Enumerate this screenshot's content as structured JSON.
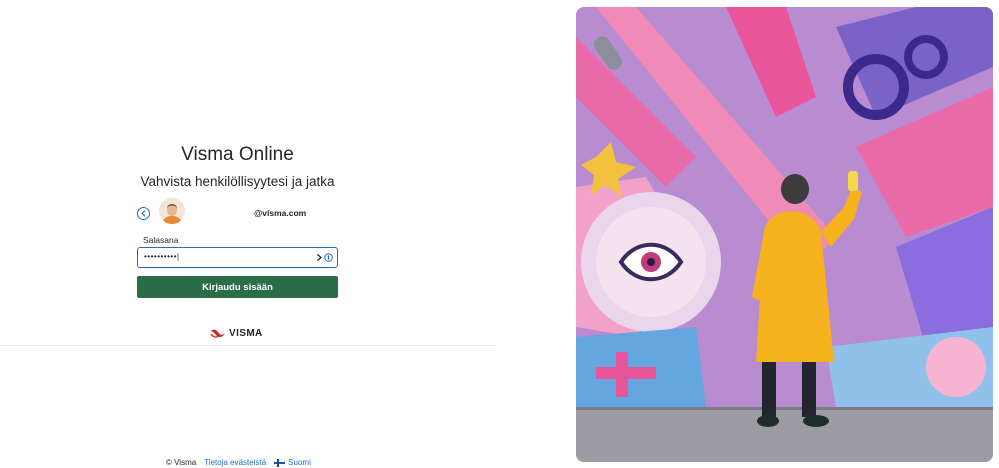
{
  "app": {
    "title": "Visma Online",
    "subtitle": "Vahvista henkilöllisyytesi ja jatka"
  },
  "account": {
    "email": "@visma.com"
  },
  "password": {
    "label": "Salasana",
    "masked_value": "••••••••••|"
  },
  "actions": {
    "signin_label": "Kirjaudu sisään"
  },
  "brand": {
    "wordmark": "VISMA",
    "accent_color": "#d6272d",
    "button_color": "#2b6d46",
    "link_color": "#1b6ec2"
  },
  "footer": {
    "copyright": "© Visma",
    "cookies_link": "Tietoja evästeistä",
    "language": "Suomi"
  },
  "icons": [
    "chevron-left-icon",
    "avatar",
    "password-manager-icon",
    "visma-logo-icon",
    "finland-flag-icon"
  ]
}
